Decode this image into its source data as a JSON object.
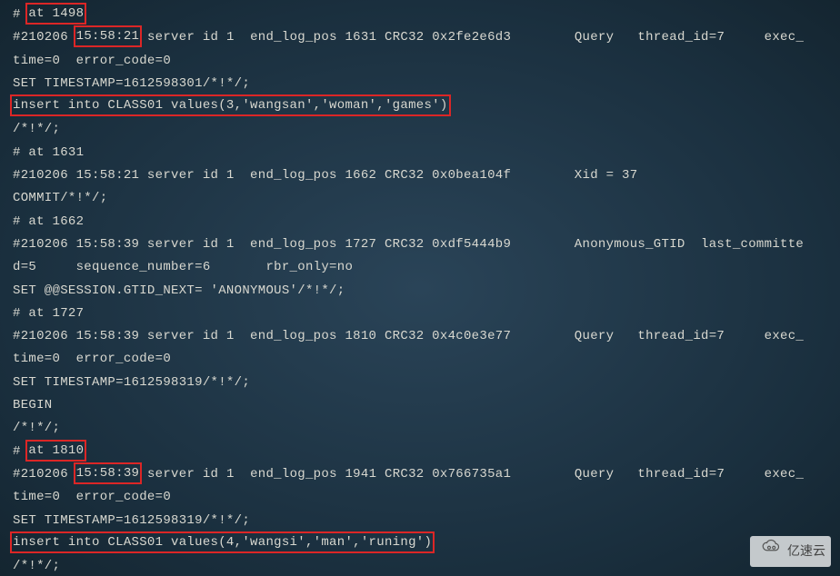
{
  "lines": {
    "l1_a": "# ",
    "l1_hl": "at 1498",
    "l2_a": "#210206 ",
    "l2_hl": "15:58:21",
    "l2_b": " server id 1  end_log_pos 1631 CRC32 0x2fe2e6d3        Query   thread_id=7     exec_",
    "l3": "time=0  error_code=0",
    "l4": "SET TIMESTAMP=1612598301/*!*/;",
    "l5_hl": "insert into CLASS01 values(3,'wangsan','woman','games')",
    "l6": "/*!*/;",
    "l7": "# at 1631",
    "l8": "#210206 15:58:21 server id 1  end_log_pos 1662 CRC32 0x0bea104f        Xid = 37",
    "l9": "COMMIT/*!*/;",
    "l10": "# at 1662",
    "l11": "#210206 15:58:39 server id 1  end_log_pos 1727 CRC32 0xdf5444b9        Anonymous_GTID  last_committe",
    "l12": "d=5     sequence_number=6       rbr_only=no",
    "l13": "SET @@SESSION.GTID_NEXT= 'ANONYMOUS'/*!*/;",
    "l14": "# at 1727",
    "l15": "#210206 15:58:39 server id 1  end_log_pos 1810 CRC32 0x4c0e3e77        Query   thread_id=7     exec_",
    "l16": "time=0  error_code=0",
    "l17": "SET TIMESTAMP=1612598319/*!*/;",
    "l18": "BEGIN",
    "l19": "/*!*/;",
    "l20_a": "# ",
    "l20_hl": "at 1810",
    "l21_a": "#210206 ",
    "l21_hl": "15:58:39",
    "l21_b": " server id 1  end_log_pos 1941 CRC32 0x766735a1        Query   thread_id=7     exec_",
    "l22": "time=0  error_code=0",
    "l23": "SET TIMESTAMP=1612598319/*!*/;",
    "l24_hl": "insert into CLASS01 values(4,'wangsi','man','runing')",
    "l25": "/*!*/;"
  },
  "watermark": {
    "text": "亿速云"
  }
}
